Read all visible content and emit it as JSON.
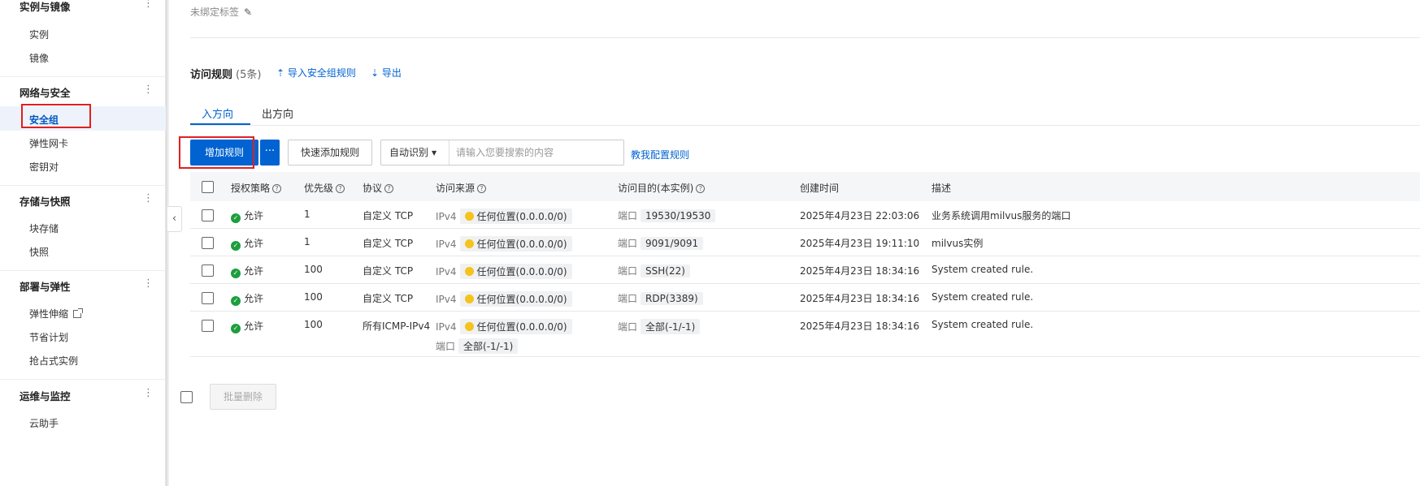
{
  "sidebar": {
    "groups": [
      {
        "title": "实例与镜像",
        "items": [
          "实例",
          "镜像"
        ]
      },
      {
        "title": "网络与安全",
        "items": [
          "安全组",
          "弹性网卡",
          "密钥对"
        ]
      },
      {
        "title": "存储与快照",
        "items": [
          "块存储",
          "快照"
        ]
      },
      {
        "title": "部署与弹性",
        "items": [
          "弹性伸缩",
          "节省计划",
          "抢占式实例"
        ]
      },
      {
        "title": "运维与监控",
        "items": [
          "云助手"
        ]
      }
    ],
    "active_item": "安全组",
    "menu_glyph": "⋮",
    "collapse_glyph": "‹"
  },
  "header": {
    "tag_text": "未绑定标签",
    "edit_icon": "✎"
  },
  "rules": {
    "title": "访问规则",
    "count": "(5条)",
    "import_link": "导入安全组规则",
    "import_icon": "⇡",
    "export_link": "导出",
    "export_icon": "⇣"
  },
  "tabs": [
    {
      "label": "入方向",
      "selected": true
    },
    {
      "label": "出方向",
      "selected": false
    }
  ],
  "toolbar": {
    "add_rule": "增加规则",
    "more": "···",
    "quick_add": "快速添加规则",
    "search_mode": "自动识别",
    "search_placeholder": "请输入您要搜索的内容",
    "help_link": "教我配置规则"
  },
  "table": {
    "columns": [
      "授权策略",
      "优先级",
      "协议",
      "访问来源",
      "访问目的(本实例)",
      "创建时间",
      "描述"
    ],
    "rows": [
      {
        "policy": "允许",
        "priority": "1",
        "protocol": "自定义 TCP",
        "src_ver": "IPv4",
        "source": "任何位置(0.0.0.0/0)",
        "dest_label": "端口",
        "dest": "19530/19530",
        "time": "2025年4月23日 22:03:06",
        "desc": "业务系统调用milvus服务的端口"
      },
      {
        "policy": "允许",
        "priority": "1",
        "protocol": "自定义 TCP",
        "src_ver": "IPv4",
        "source": "任何位置(0.0.0.0/0)",
        "dest_label": "端口",
        "dest": "9091/9091",
        "time": "2025年4月23日 19:11:10",
        "desc": "milvus实例"
      },
      {
        "policy": "允许",
        "priority": "100",
        "protocol": "自定义 TCP",
        "src_ver": "IPv4",
        "source": "任何位置(0.0.0.0/0)",
        "dest_label": "端口",
        "dest": "SSH(22)",
        "time": "2025年4月23日 18:34:16",
        "desc": "System created rule."
      },
      {
        "policy": "允许",
        "priority": "100",
        "protocol": "自定义 TCP",
        "src_ver": "IPv4",
        "source": "任何位置(0.0.0.0/0)",
        "dest_label": "端口",
        "dest": "RDP(3389)",
        "time": "2025年4月23日 18:34:16",
        "desc": "System created rule."
      },
      {
        "policy": "允许",
        "priority": "100",
        "protocol": "所有ICMP-IPv4",
        "src_ver": "IPv4",
        "source": "任何位置(0.0.0.0/0)",
        "dest_label": "端口",
        "dest": "全部(-1/-1)",
        "time": "2025年4月23日 18:34:16",
        "desc": "System created rule.",
        "src_port_label": "端口",
        "src_port": "全部(-1/-1)"
      }
    ]
  },
  "batch_delete": "批量删除",
  "colors": {
    "primary": "#0063d1",
    "allow": "#1e9e3e",
    "any_source": "#f5c31c",
    "highlight": "#e02020"
  }
}
